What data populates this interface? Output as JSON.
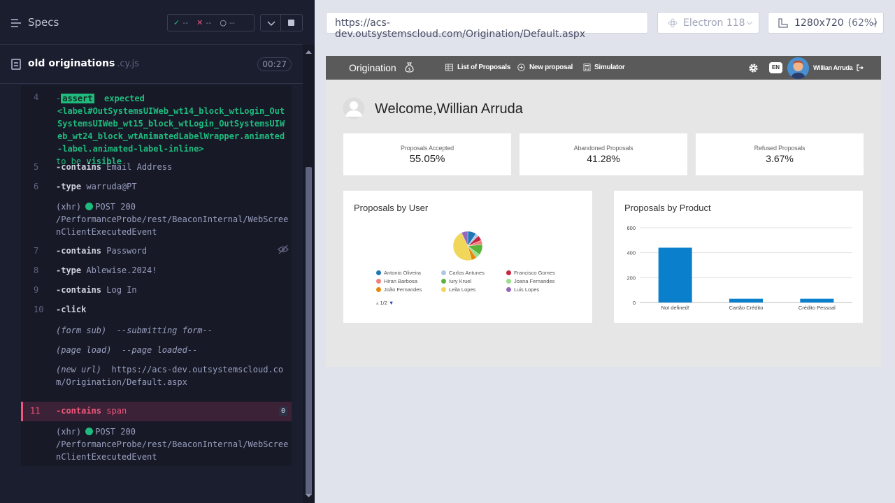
{
  "runner": {
    "specs_title": "Specs",
    "stats": {
      "passed": "--",
      "failed": "--",
      "pending": "--"
    },
    "spec_file": {
      "name": "old originations",
      "ext": ".cy.js",
      "duration": "00:27"
    },
    "log": {
      "l4_num": "4",
      "l4_assert": "assert",
      "l4_expected": "expected",
      "l4_selector": "<label#OutSystemsUIWeb_wt14_block_wtLogin_OutSystemsUIWeb_wt15_block_wtLogin_OutSystemsUIWeb_wt24_block_wtAnimatedLabelWrapper.animated-label.animated-label-inline>",
      "l4_tobe": "to be",
      "l4_visible": "visible",
      "l5_num": "5",
      "l5_cmd": "-contains",
      "l5_arg": "Email Address",
      "l6_num": "6",
      "l6_cmd": "-type",
      "l6_arg": "warruda@PT",
      "xhr1_label": "(xhr)",
      "xhr1_method": "POST 200",
      "xhr1_url": "/PerformanceProbe/rest/BeaconInternal/WebScreenClientExecutedEvent",
      "l7_num": "7",
      "l7_cmd": "-contains",
      "l7_arg": "Password",
      "l8_num": "8",
      "l8_cmd": "-type",
      "l8_arg": "Ablewise.2024!",
      "l9_num": "9",
      "l9_cmd": "-contains",
      "l9_arg": "Log In",
      "l10_num": "10",
      "l10_cmd": "-click",
      "form_sub": "(form sub)",
      "form_sub_msg": "--submitting form--",
      "page_load": "(page load)",
      "page_load_msg": "--page loaded--",
      "new_url": "(new url)",
      "new_url_val": "https://acs-dev.outsystemscloud.com/Origination/Default.aspx",
      "l11_num": "11",
      "l11_cmd": "-contains",
      "l11_arg": "span",
      "l11_badge": "0",
      "xhr2_label": "(xhr)",
      "xhr2_method": "POST 200",
      "xhr2_url": "/PerformanceProbe/rest/BeaconInternal/WebScreenClientExecutedEvent"
    }
  },
  "browser": {
    "url": "https://acs-dev.outsystemscloud.com/Origination/Default.aspx",
    "browser_name": "Electron 118",
    "viewport": "1280x720",
    "scale": "(62%)"
  },
  "app": {
    "title": "Origination",
    "nav": {
      "list": "List of Proposals",
      "new": "New proposal",
      "sim": "Simulator"
    },
    "lang": "EN",
    "user": "Willian Arruda",
    "welcome": "Welcome,Willian Arruda",
    "cards": [
      {
        "label": "Proposals Accepted",
        "value": "55.05%"
      },
      {
        "label": "Abandoned Proposals",
        "value": "41.28%"
      },
      {
        "label": "Refused Proposals",
        "value": "3.67%"
      }
    ],
    "pie_title": "Proposals by User",
    "legend": [
      {
        "name": "Antonio Oliveira",
        "color": "#1f77b4"
      },
      {
        "name": "Carlos Antunes",
        "color": "#aec7e8"
      },
      {
        "name": "Francisco Gomes",
        "color": "#c7253d"
      },
      {
        "name": "Hiran Barbosa",
        "color": "#f08080"
      },
      {
        "name": "Iury Kruel",
        "color": "#5ab43c"
      },
      {
        "name": "Joana Fernandes",
        "color": "#98df8a"
      },
      {
        "name": "João Fernandes",
        "color": "#e8890c"
      },
      {
        "name": "Leila Lopes",
        "color": "#f0d75a"
      },
      {
        "name": "Luis Lopes",
        "color": "#9467bd"
      }
    ],
    "pager": "1/2",
    "bar_title": "Proposals by Product"
  },
  "chart_data": [
    {
      "type": "pie",
      "title": "Proposals by User",
      "categories": [
        "Antonio Oliveira",
        "Carlos Antunes",
        "Francisco Gomes",
        "Hiran Barbosa",
        "Iury Kruel",
        "Joana Fernandes",
        "João Fernandes",
        "Leila Lopes",
        "Luis Lopes"
      ],
      "values": [
        8,
        3,
        5,
        4,
        10,
        4,
        5,
        40,
        6
      ],
      "colors": [
        "#1f77b4",
        "#aec7e8",
        "#c7253d",
        "#f08080",
        "#5ab43c",
        "#98df8a",
        "#e8890c",
        "#f0d75a",
        "#9467bd"
      ]
    },
    {
      "type": "bar",
      "title": "Proposals by Product",
      "categories": [
        "Not defined!",
        "Cartão Crédito",
        "Crédito Pessoal"
      ],
      "values": [
        440,
        30,
        30
      ],
      "ylim": [
        0,
        600
      ],
      "yticks": [
        "0",
        "200",
        "400",
        "600"
      ],
      "color": "#0a7fcc",
      "grid": true
    }
  ]
}
